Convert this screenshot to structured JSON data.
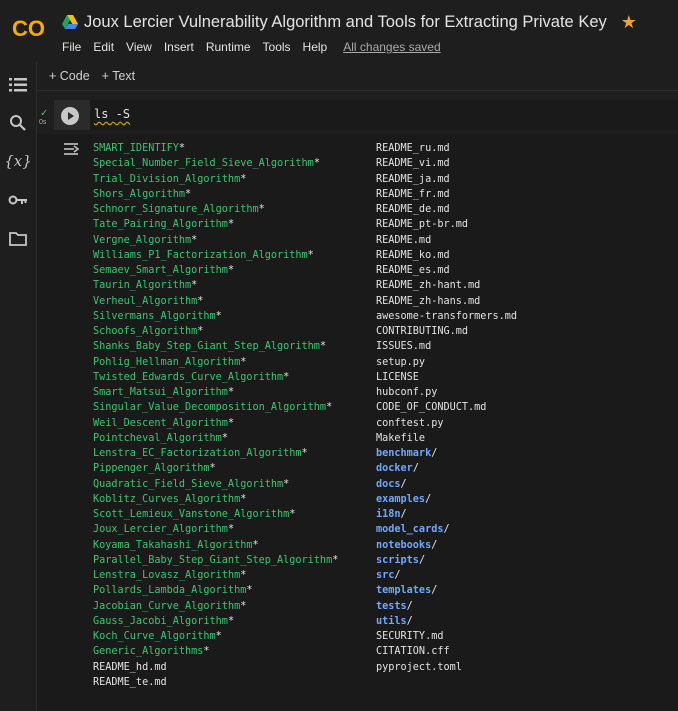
{
  "header": {
    "logo_text": "CO",
    "title": "Joux Lercier Vulnerability Algorithm and Tools for Extracting Private Key",
    "menu": [
      "File",
      "Edit",
      "View",
      "Insert",
      "Runtime",
      "Tools",
      "Help"
    ],
    "save_status": "All changes saved",
    "accent": "#f29d38"
  },
  "rail": {
    "icons": [
      "menu-icon",
      "search-icon",
      "variables-icon",
      "key-icon",
      "folder-icon"
    ],
    "variables_glyph": "{x}"
  },
  "toolbar": {
    "code_label": "+ Code",
    "text_label": "+ Text"
  },
  "cell": {
    "status": "✓",
    "exec_time": "0s",
    "source": "ls -S"
  },
  "output": {
    "column1": [
      {
        "name": "SMART_IDENTIFY",
        "suffix": "*",
        "type": "exe"
      },
      {
        "name": "Special_Number_Field_Sieve_Algorithm",
        "suffix": "*",
        "type": "exe"
      },
      {
        "name": "Trial_Division_Algorithm",
        "suffix": "*",
        "type": "exe"
      },
      {
        "name": "Shors_Algorithm",
        "suffix": "*",
        "type": "exe"
      },
      {
        "name": "Schnorr_Signature_Algorithm",
        "suffix": "*",
        "type": "exe"
      },
      {
        "name": "Tate_Pairing_Algorithm",
        "suffix": "*",
        "type": "exe"
      },
      {
        "name": "Vergne_Algorithm",
        "suffix": "*",
        "type": "exe"
      },
      {
        "name": "Williams_P1_Factorization_Algorithm",
        "suffix": "*",
        "type": "exe"
      },
      {
        "name": "Semaev_Smart_Algorithm",
        "suffix": "*",
        "type": "exe"
      },
      {
        "name": "Taurin_Algorithm",
        "suffix": "*",
        "type": "exe"
      },
      {
        "name": "Verheul_Algorithm",
        "suffix": "*",
        "type": "exe"
      },
      {
        "name": "Silvermans_Algorithm",
        "suffix": "*",
        "type": "exe"
      },
      {
        "name": "Schoofs_Algorithm",
        "suffix": "*",
        "type": "exe"
      },
      {
        "name": "Shanks_Baby_Step_Giant_Step_Algorithm",
        "suffix": "*",
        "type": "exe"
      },
      {
        "name": "Pohlig_Hellman_Algorithm",
        "suffix": "*",
        "type": "exe"
      },
      {
        "name": "Twisted_Edwards_Curve_Algorithm",
        "suffix": "*",
        "type": "exe"
      },
      {
        "name": "Smart_Matsui_Algorithm",
        "suffix": "*",
        "type": "exe"
      },
      {
        "name": "Singular_Value_Decomposition_Algorithm",
        "suffix": "*",
        "type": "exe"
      },
      {
        "name": "Weil_Descent_Algorithm",
        "suffix": "*",
        "type": "exe"
      },
      {
        "name": "Pointcheval_Algorithm",
        "suffix": "*",
        "type": "exe"
      },
      {
        "name": "Lenstra_EC_Factorization_Algorithm",
        "suffix": "*",
        "type": "exe"
      },
      {
        "name": "Pippenger_Algorithm",
        "suffix": "*",
        "type": "exe"
      },
      {
        "name": "Quadratic_Field_Sieve_Algorithm",
        "suffix": "*",
        "type": "exe"
      },
      {
        "name": "Koblitz_Curves_Algorithm",
        "suffix": "*",
        "type": "exe"
      },
      {
        "name": "Scott_Lemieux_Vanstone_Algorithm",
        "suffix": "*",
        "type": "exe"
      },
      {
        "name": "Joux_Lercier_Algorithm",
        "suffix": "*",
        "type": "exe"
      },
      {
        "name": "Koyama_Takahashi_Algorithm",
        "suffix": "*",
        "type": "exe"
      },
      {
        "name": "Parallel_Baby_Step_Giant_Step_Algorithm",
        "suffix": "*",
        "type": "exe"
      },
      {
        "name": "Lenstra_Lovasz_Algorithm",
        "suffix": "*",
        "type": "exe"
      },
      {
        "name": "Pollards_Lambda_Algorithm",
        "suffix": "*",
        "type": "exe"
      },
      {
        "name": "Jacobian_Curve_Algorithm",
        "suffix": "*",
        "type": "exe"
      },
      {
        "name": "Gauss_Jacobi_Algorithm",
        "suffix": "*",
        "type": "exe"
      },
      {
        "name": "Koch_Curve_Algorithm",
        "suffix": "*",
        "type": "exe"
      },
      {
        "name": "Generic_Algorithms",
        "suffix": "*",
        "type": "exe"
      },
      {
        "name": "README_hd.md",
        "suffix": "",
        "type": "plain"
      },
      {
        "name": "README_te.md",
        "suffix": "",
        "type": "plain"
      }
    ],
    "column2": [
      {
        "name": "README_ru.md",
        "suffix": "",
        "type": "plain"
      },
      {
        "name": "README_vi.md",
        "suffix": "",
        "type": "plain"
      },
      {
        "name": "README_ja.md",
        "suffix": "",
        "type": "plain"
      },
      {
        "name": "README_fr.md",
        "suffix": "",
        "type": "plain"
      },
      {
        "name": "README_de.md",
        "suffix": "",
        "type": "plain"
      },
      {
        "name": "README_pt-br.md",
        "suffix": "",
        "type": "plain"
      },
      {
        "name": "README.md",
        "suffix": "",
        "type": "plain"
      },
      {
        "name": "README_ko.md",
        "suffix": "",
        "type": "plain"
      },
      {
        "name": "README_es.md",
        "suffix": "",
        "type": "plain"
      },
      {
        "name": "README_zh-hant.md",
        "suffix": "",
        "type": "plain"
      },
      {
        "name": "README_zh-hans.md",
        "suffix": "",
        "type": "plain"
      },
      {
        "name": "awesome-transformers.md",
        "suffix": "",
        "type": "plain"
      },
      {
        "name": "CONTRIBUTING.md",
        "suffix": "",
        "type": "plain"
      },
      {
        "name": "ISSUES.md",
        "suffix": "",
        "type": "plain"
      },
      {
        "name": "setup.py",
        "suffix": "",
        "type": "plain"
      },
      {
        "name": "LICENSE",
        "suffix": "",
        "type": "plain"
      },
      {
        "name": "hubconf.py",
        "suffix": "",
        "type": "plain"
      },
      {
        "name": "CODE_OF_CONDUCT.md",
        "suffix": "",
        "type": "plain"
      },
      {
        "name": "conftest.py",
        "suffix": "",
        "type": "plain"
      },
      {
        "name": "Makefile",
        "suffix": "",
        "type": "plain"
      },
      {
        "name": "benchmark",
        "suffix": "/",
        "type": "dir"
      },
      {
        "name": "docker",
        "suffix": "/",
        "type": "dir"
      },
      {
        "name": "docs",
        "suffix": "/",
        "type": "dir"
      },
      {
        "name": "examples",
        "suffix": "/",
        "type": "dir"
      },
      {
        "name": "i18n",
        "suffix": "/",
        "type": "dir"
      },
      {
        "name": "model_cards",
        "suffix": "/",
        "type": "dir"
      },
      {
        "name": "notebooks",
        "suffix": "/",
        "type": "dir"
      },
      {
        "name": "scripts",
        "suffix": "/",
        "type": "dir"
      },
      {
        "name": "src",
        "suffix": "/",
        "type": "dir"
      },
      {
        "name": "templates",
        "suffix": "/",
        "type": "dir"
      },
      {
        "name": "tests",
        "suffix": "/",
        "type": "dir"
      },
      {
        "name": "utils",
        "suffix": "/",
        "type": "dir"
      },
      {
        "name": "SECURITY.md",
        "suffix": "",
        "type": "plain"
      },
      {
        "name": "CITATION.cff",
        "suffix": "",
        "type": "plain"
      },
      {
        "name": "pyproject.toml",
        "suffix": "",
        "type": "plain"
      }
    ],
    "colors": {
      "exe": "#37c871",
      "dir": "#6fa8ff",
      "plain": "#e3e3e3"
    }
  }
}
